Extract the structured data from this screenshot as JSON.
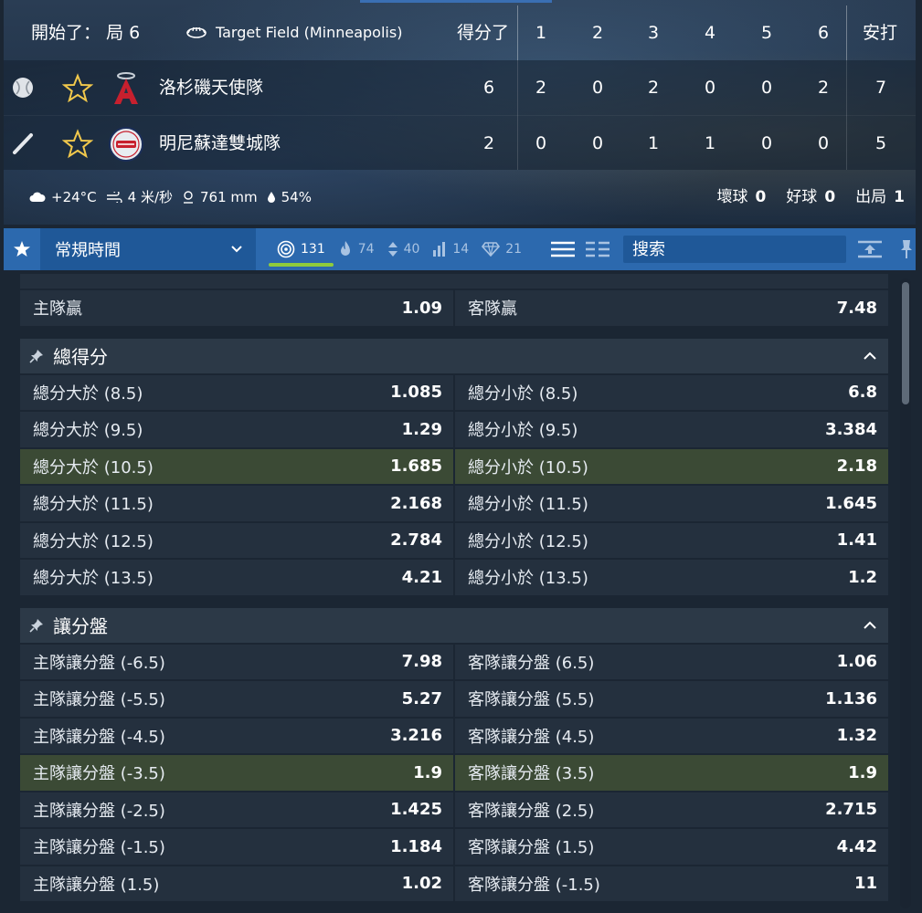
{
  "match": {
    "status_label": "開始了：",
    "inning": "局 6",
    "venue": "Target Field (Minneapolis)",
    "score_header": "得分了",
    "innings": [
      "1",
      "2",
      "3",
      "4",
      "5",
      "6"
    ],
    "hits_header": "安打",
    "teams": [
      {
        "name": "洛杉磯天使隊",
        "score": "6",
        "innings": [
          "2",
          "0",
          "2",
          "0",
          "0",
          "2"
        ],
        "hits": "7",
        "status_icon": "baseball-icon",
        "logo": "angels-logo"
      },
      {
        "name": "明尼蘇達雙城隊",
        "score": "2",
        "innings": [
          "0",
          "0",
          "1",
          "1",
          "0",
          "0"
        ],
        "hits": "5",
        "status_icon": "bat-icon",
        "logo": "twins-logo"
      }
    ],
    "weather": {
      "temp": "+24°C",
      "wind": "4 米/秒",
      "pressure": "761 mm",
      "humidity": "54%"
    },
    "counts": {
      "balls_label": "壞球",
      "balls": "0",
      "strikes_label": "好球",
      "strikes": "0",
      "outs_label": "出局",
      "outs": "1"
    }
  },
  "toolbar": {
    "period": "常規時間",
    "stats": [
      {
        "icon": "target-icon",
        "value": "131"
      },
      {
        "icon": "fire-icon",
        "value": "74"
      },
      {
        "icon": "updown-icon",
        "value": "40"
      },
      {
        "icon": "bars-icon",
        "value": "14"
      },
      {
        "icon": "diamond-icon",
        "value": "21"
      }
    ],
    "search_placeholder": "搜索"
  },
  "markets": {
    "top_row": {
      "home_label": "主隊贏",
      "home_odd": "1.09",
      "away_label": "客隊贏",
      "away_odd": "7.48"
    },
    "total": {
      "title": "總得分",
      "rows": [
        {
          "over": "總分大於 (8.5)",
          "over_odd": "1.085",
          "under": "總分小於 (8.5)",
          "under_odd": "6.8"
        },
        {
          "over": "總分大於 (9.5)",
          "over_odd": "1.29",
          "under": "總分小於 (9.5)",
          "under_odd": "3.384"
        },
        {
          "over": "總分大於 (10.5)",
          "over_odd": "1.685",
          "under": "總分小於 (10.5)",
          "under_odd": "2.18"
        },
        {
          "over": "總分大於 (11.5)",
          "over_odd": "2.168",
          "under": "總分小於 (11.5)",
          "under_odd": "1.645"
        },
        {
          "over": "總分大於 (12.5)",
          "over_odd": "2.784",
          "under": "總分小於 (12.5)",
          "under_odd": "1.41"
        },
        {
          "over": "總分大於 (13.5)",
          "over_odd": "4.21",
          "under": "總分小於 (13.5)",
          "under_odd": "1.2"
        }
      ]
    },
    "handicap": {
      "title": "讓分盤",
      "rows": [
        {
          "home": "主隊讓分盤 (-6.5)",
          "home_odd": "7.98",
          "away": "客隊讓分盤 (6.5)",
          "away_odd": "1.06"
        },
        {
          "home": "主隊讓分盤 (-5.5)",
          "home_odd": "5.27",
          "away": "客隊讓分盤 (5.5)",
          "away_odd": "1.136"
        },
        {
          "home": "主隊讓分盤 (-4.5)",
          "home_odd": "3.216",
          "away": "客隊讓分盤 (4.5)",
          "away_odd": "1.32"
        },
        {
          "home": "主隊讓分盤 (-3.5)",
          "home_odd": "1.9",
          "away": "客隊讓分盤 (3.5)",
          "away_odd": "1.9"
        },
        {
          "home": "主隊讓分盤 (-2.5)",
          "home_odd": "1.425",
          "away": "客隊讓分盤 (2.5)",
          "away_odd": "2.715"
        },
        {
          "home": "主隊讓分盤 (-1.5)",
          "home_odd": "1.184",
          "away": "客隊讓分盤 (1.5)",
          "away_odd": "4.42"
        },
        {
          "home": "主隊讓分盤 (1.5)",
          "home_odd": "1.02",
          "away": "客隊讓分盤 (-1.5)",
          "away_odd": "11"
        }
      ]
    }
  },
  "colors": {
    "toolbar": "#2c69ae",
    "highlight_row": "#3b4a35",
    "accent_underline": "#8fcb3c",
    "star": "#f2c94c"
  }
}
